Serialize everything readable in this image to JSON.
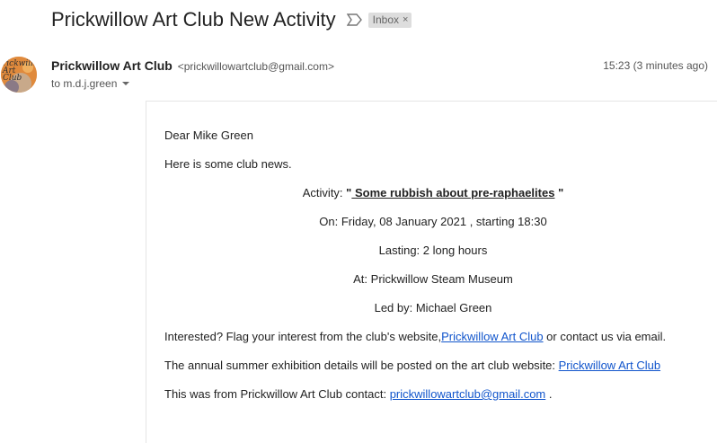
{
  "subject": "Prickwillow Art Club New Activity",
  "label_chip": {
    "text": "Inbox",
    "close_glyph": "×"
  },
  "icons": {
    "importance": "importance-marker-icon",
    "expand": "chevron-down-icon",
    "label_remove": "close-icon"
  },
  "avatar": {
    "text": "rickwillo\nArt\nClub"
  },
  "sender": {
    "name": "Prickwillow Art Club",
    "email": "<prickwillowartclub@gmail.com>"
  },
  "time": "15:23 (3 minutes ago)",
  "to": "to m.d.j.green",
  "body": {
    "greeting": "Dear Mike Green",
    "intro": "Here is some club news.",
    "activity_prefix": "Activity: ",
    "activity_open_quote": "\"",
    "activity_title": " Some rubbish about pre-raphaelites",
    "activity_close_quote": " \"",
    "on": "On: Friday, 08 January 2021 , starting 18:30",
    "lasting": "Lasting: 2 long hours",
    "at": "At:  Prickwillow Steam Museum",
    "led_by": "Led by: Michael Green",
    "interested_prefix": "Interested? Flag your interest from the club's website,",
    "interested_link": "Prickwillow Art Club",
    "interested_suffix": " or contact us via email.",
    "exhibition_prefix": "The annual summer exhibition details will be posted on the art club website: ",
    "exhibition_link": "Prickwillow Art Club",
    "contact_prefix": "This was from Prickwillow Art Club contact: ",
    "contact_link": "prickwillowartclub@gmail.com",
    "contact_suffix": " ."
  },
  "colors": {
    "link": "#1155cc",
    "chip_bg": "#dddddd",
    "avatar_bg": "#e08a3c"
  }
}
